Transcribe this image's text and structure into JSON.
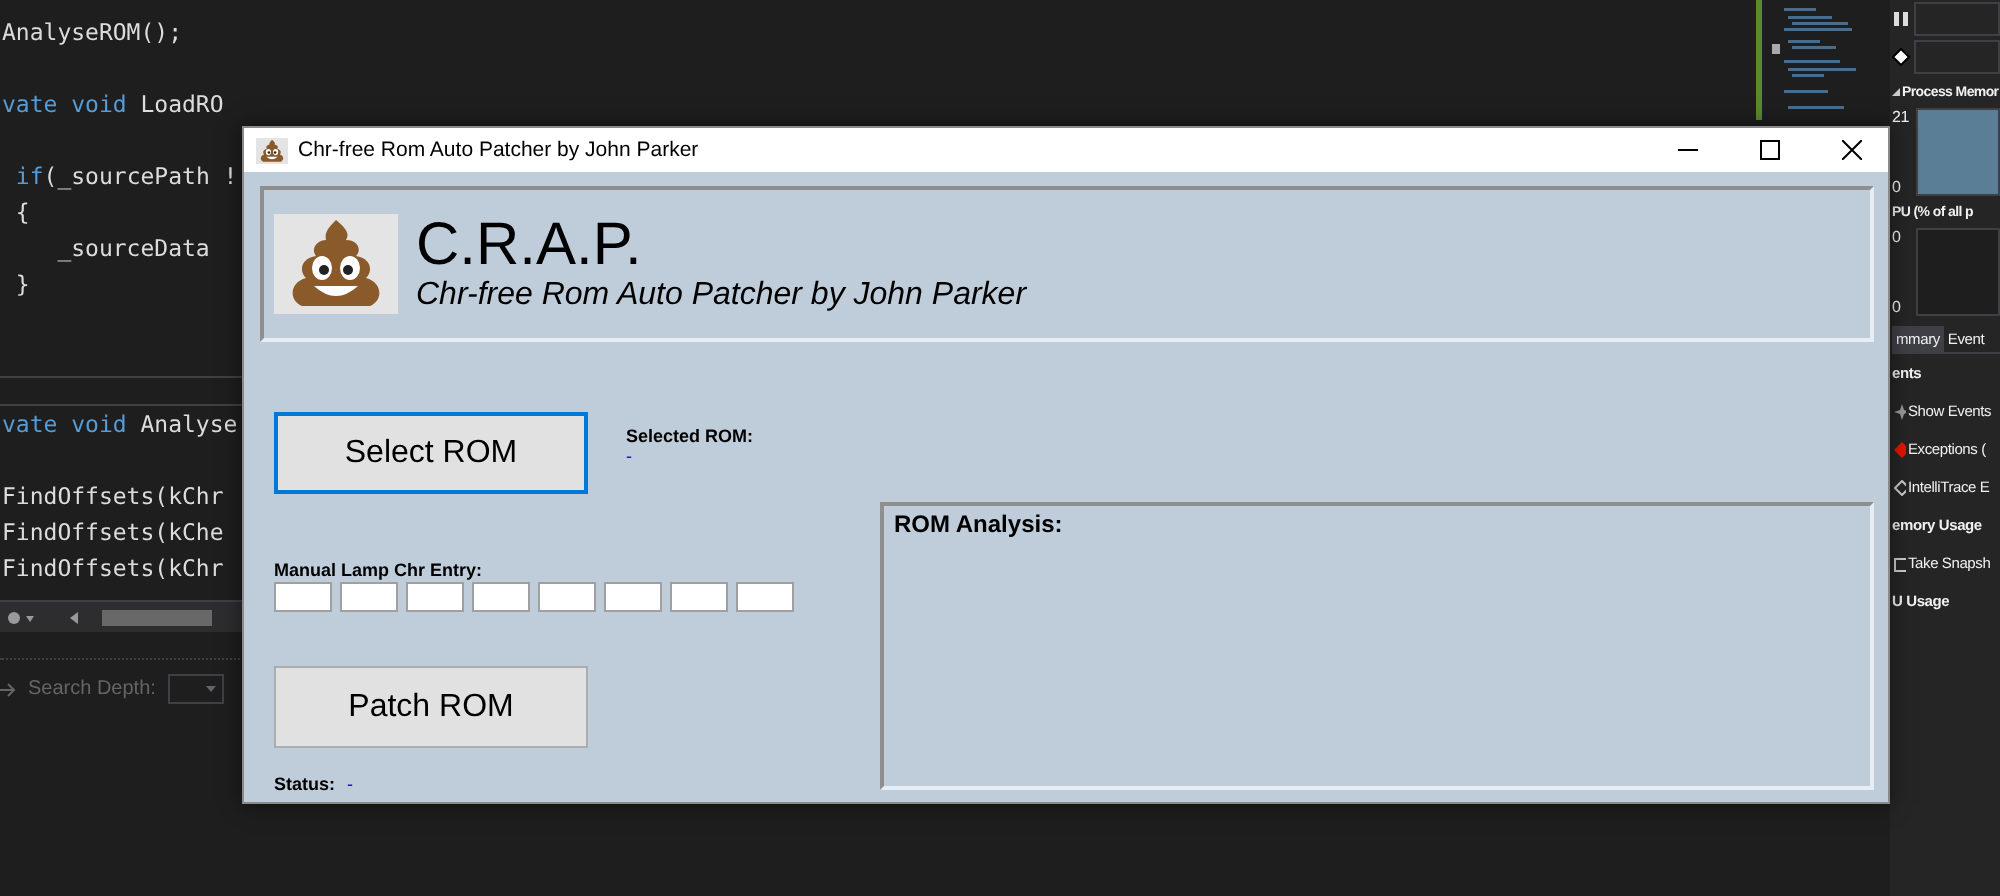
{
  "editor_top": {
    "sections": [
      {
        "lines": [
          [
            {
              "kind": "plain",
              "text": "AnalyseROM();"
            }
          ]
        ]
      },
      {
        "lines": [
          [
            {
              "kind": "keyword",
              "text": "vate void"
            },
            {
              "kind": "plain",
              "text": " LoadRO"
            }
          ]
        ]
      },
      {
        "lines": [
          [
            {
              "kind": "keyword",
              "text": " if"
            },
            {
              "kind": "plain",
              "text": "(_sourcePath !"
            }
          ],
          [
            {
              "kind": "plain",
              "text": " {"
            }
          ],
          [
            {
              "kind": "plain",
              "text": "    _sourceData"
            }
          ],
          [
            {
              "kind": "plain",
              "text": " }"
            }
          ]
        ]
      }
    ]
  },
  "editor_bottom": {
    "sections": [
      {
        "lines": [
          [
            {
              "kind": "keyword",
              "text": "vate void"
            },
            {
              "kind": "plain",
              "text": " Analyse"
            }
          ]
        ]
      },
      {
        "lines": [
          [
            {
              "kind": "plain",
              "text": "FindOffsets(kChr"
            }
          ],
          [
            {
              "kind": "plain",
              "text": "FindOffsets(kChe"
            }
          ],
          [
            {
              "kind": "plain",
              "text": "FindOffsets(kChr"
            }
          ]
        ]
      }
    ]
  },
  "search": {
    "label": "Search Depth:"
  },
  "diagnostics": {
    "memory": {
      "title": "Process Memor",
      "max": "21",
      "min": "0"
    },
    "cpu": {
      "title": "PU (% of all p",
      "max": "0",
      "min": "0"
    },
    "tabs": [
      {
        "label": "mmary",
        "selected": true
      },
      {
        "label": "Event",
        "selected": false
      }
    ],
    "rows": [
      {
        "kind": "heading",
        "label": "ents"
      },
      {
        "kind": "events",
        "label": "Show Events"
      },
      {
        "kind": "exceptions",
        "label": "Exceptions ("
      },
      {
        "kind": "trace",
        "label": "IntelliTrace E"
      },
      {
        "kind": "heading",
        "label": "emory Usage"
      },
      {
        "kind": "snapshot",
        "label": "Take Snapsh"
      },
      {
        "kind": "heading",
        "label": "U Usage"
      }
    ]
  },
  "window": {
    "title": "Chr-free Rom Auto Patcher by John Parker",
    "header": {
      "title": "C.R.A.P.",
      "subtitle": "Chr-free Rom Auto Patcher by John Parker"
    },
    "select_button": {
      "label": "Select ROM",
      "focused": true
    },
    "selected_rom": {
      "label": "Selected ROM:",
      "value": "-"
    },
    "lamp_entry": {
      "label": "Manual Lamp Chr Entry:",
      "fields": [
        {
          "kind": "text"
        },
        {
          "kind": "text"
        },
        {
          "kind": "text"
        },
        {
          "kind": "text"
        },
        {
          "kind": "text"
        },
        {
          "kind": "text"
        },
        {
          "kind": "text"
        },
        {
          "kind": "text"
        }
      ]
    },
    "patch_button": {
      "label": "Patch ROM",
      "focused": false
    },
    "status": {
      "label": "Status:",
      "value": "-"
    },
    "analysis": {
      "title": "ROM Analysis:"
    }
  }
}
